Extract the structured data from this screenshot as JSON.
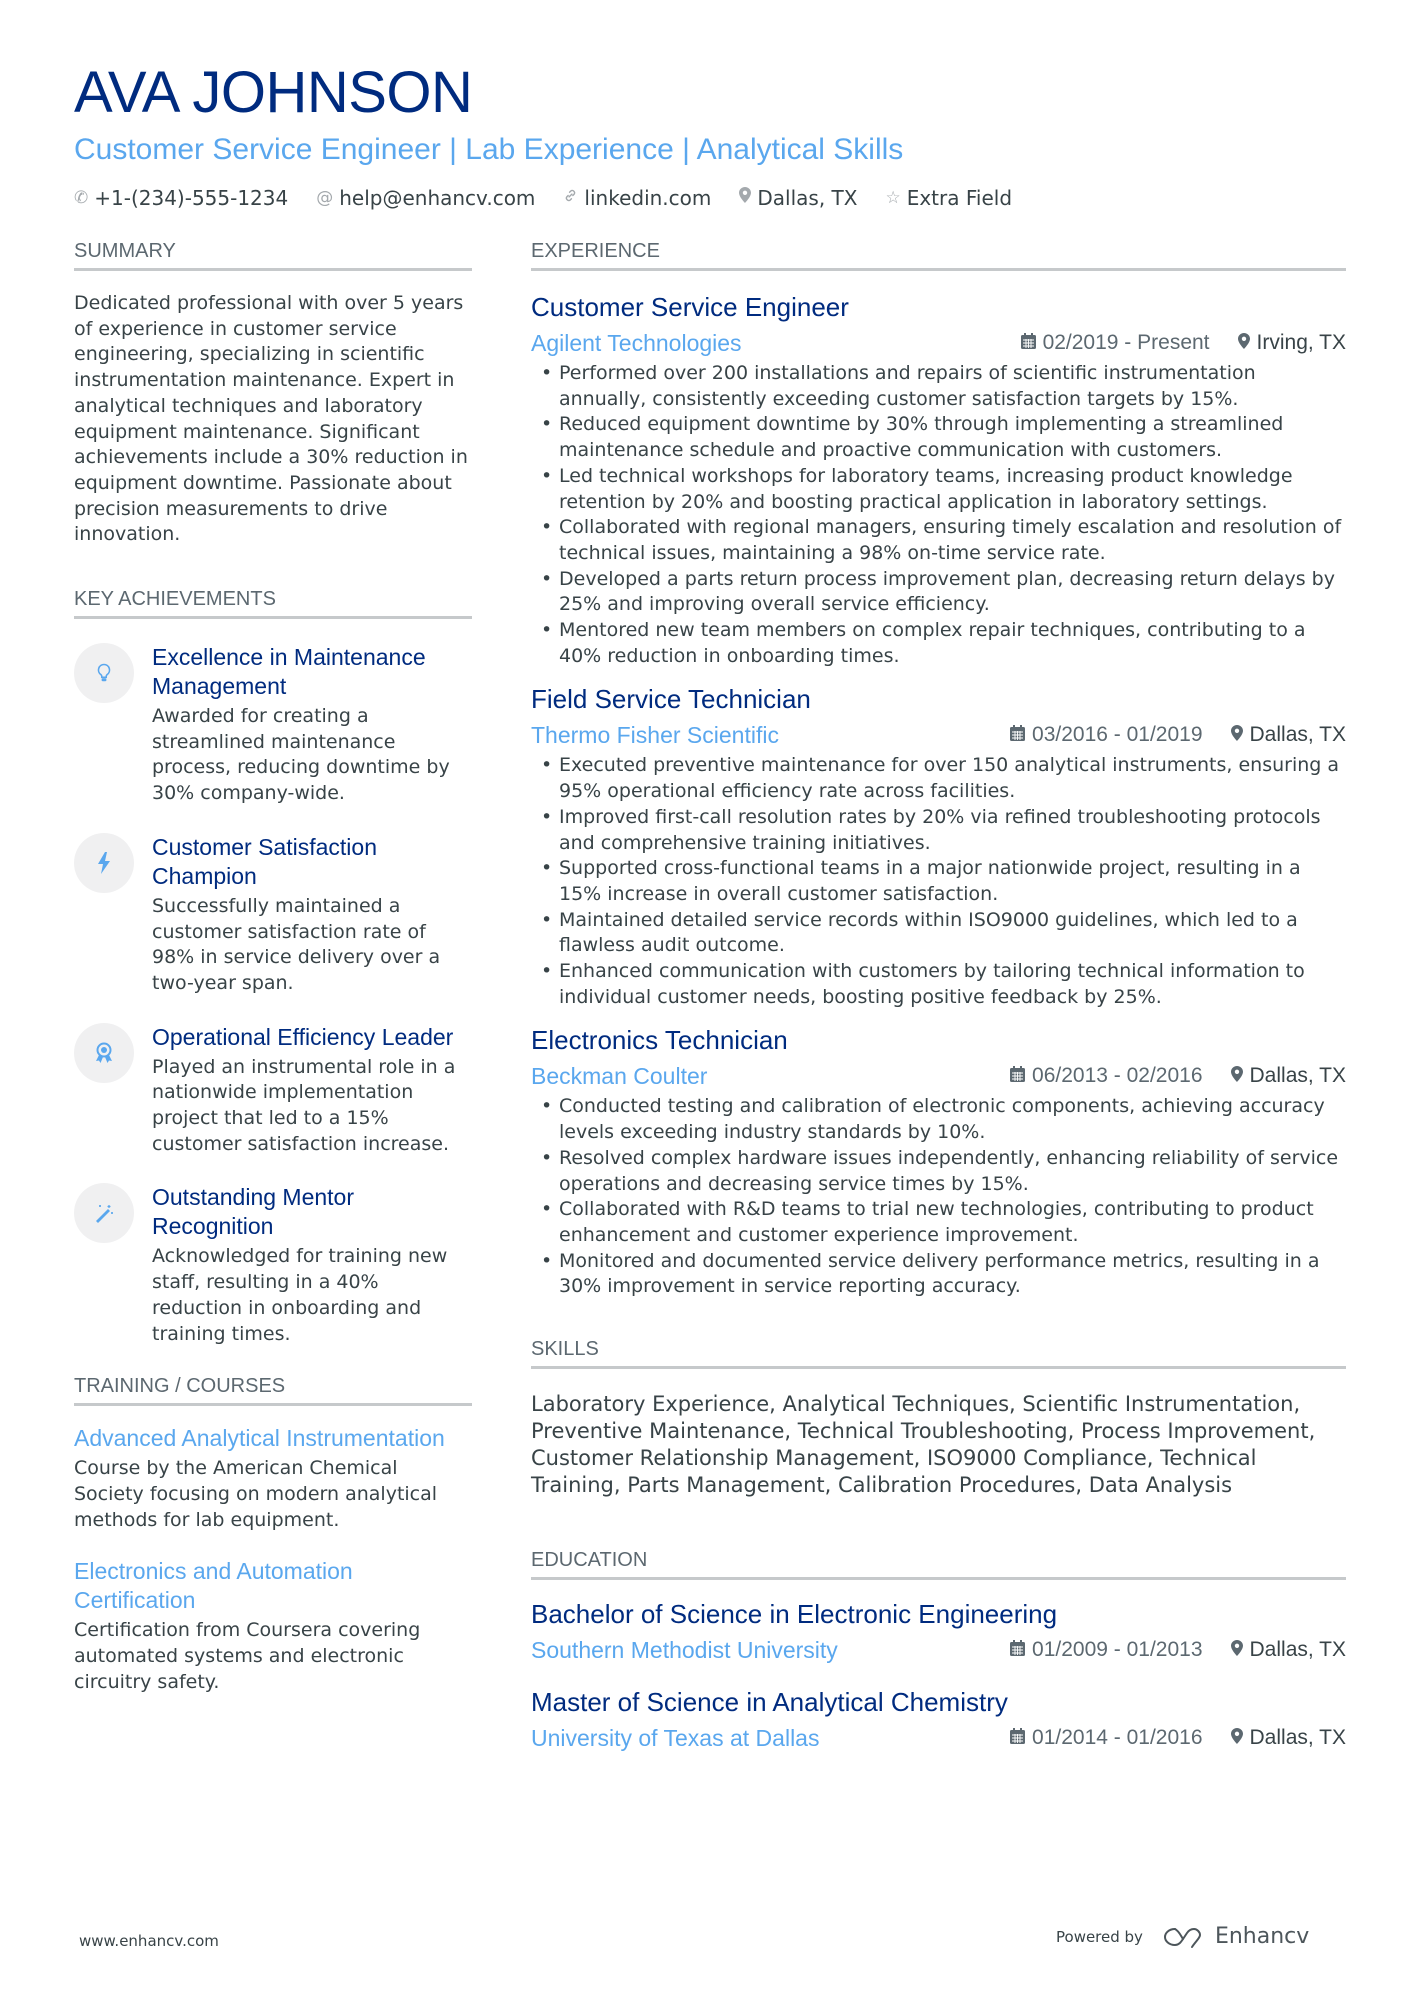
{
  "header": {
    "name": "AVA JOHNSON",
    "headline": "Customer Service Engineer | Lab Experience | Analytical Skills",
    "contacts": [
      {
        "icon": "phone-icon",
        "glyph": "✆",
        "text": "+1-(234)-555-1234"
      },
      {
        "icon": "at-icon",
        "glyph": "@",
        "text": "help@enhancv.com"
      },
      {
        "icon": "link-icon",
        "glyph": "🔗︎",
        "text": "linkedin.com"
      },
      {
        "icon": "location-icon",
        "glyph": "⚲",
        "text": "Dallas, TX"
      },
      {
        "icon": "star-icon",
        "glyph": "☆",
        "text": "Extra Field"
      }
    ]
  },
  "summary": {
    "title": "SUMMARY",
    "text": "Dedicated professional with over 5 years of experience in customer service engineering, specializing in scientific instrumentation maintenance. Expert in analytical techniques and laboratory equipment maintenance. Significant achievements include a 30% reduction in equipment downtime. Passionate about precision measurements to drive innovation."
  },
  "achievements": {
    "title": "KEY ACHIEVEMENTS",
    "items": [
      {
        "icon": "lightbulb-icon",
        "title": "Excellence in Maintenance Management",
        "desc": "Awarded for creating a streamlined maintenance process, reducing downtime by 30% company-wide."
      },
      {
        "icon": "lightning-icon",
        "title": "Customer Satisfaction Champion",
        "desc": "Successfully maintained a customer satisfaction rate of 98% in service delivery over a two-year span."
      },
      {
        "icon": "award-ribbon-icon",
        "title": "Operational Efficiency Leader",
        "desc": "Played an instrumental role in a nationwide implementation project that led to a 15% customer satisfaction increase."
      },
      {
        "icon": "magic-wand-icon",
        "title": "Outstanding Mentor Recognition",
        "desc": "Acknowledged for training new staff, resulting in a 40% reduction in onboarding and training times."
      }
    ]
  },
  "training": {
    "title": "TRAINING / COURSES",
    "items": [
      {
        "title": "Advanced Analytical Instrumentation",
        "desc": "Course by the American Chemical Society focusing on modern analytical methods for lab equipment."
      },
      {
        "title": "Electronics and Automation Certification",
        "desc": "Certification from Coursera covering automated systems and electronic circuitry safety."
      }
    ]
  },
  "experience": {
    "title": "EXPERIENCE",
    "jobs": [
      {
        "title": "Customer Service Engineer",
        "company": "Agilent Technologies",
        "dates": "02/2019 - Present",
        "location": "Irving, TX",
        "bullets": [
          "Performed over 200 installations and repairs of scientific instrumentation annually, consistently exceeding customer satisfaction targets by 15%.",
          "Reduced equipment downtime by 30% through implementing a streamlined maintenance schedule and proactive communication with customers.",
          "Led technical workshops for laboratory teams, increasing product knowledge retention by 20% and boosting practical application in laboratory settings.",
          "Collaborated with regional managers, ensuring timely escalation and resolution of technical issues, maintaining a 98% on-time service rate.",
          "Developed a parts return process improvement plan, decreasing return delays by 25% and improving overall service efficiency.",
          "Mentored new team members on complex repair techniques, contributing to a 40% reduction in onboarding times."
        ]
      },
      {
        "title": "Field Service Technician",
        "company": "Thermo Fisher Scientific",
        "dates": "03/2016 - 01/2019",
        "location": "Dallas, TX",
        "bullets": [
          "Executed preventive maintenance for over 150 analytical instruments, ensuring a 95% operational efficiency rate across facilities.",
          "Improved first-call resolution rates by 20% via refined troubleshooting protocols and comprehensive training initiatives.",
          "Supported cross-functional teams in a major nationwide project, resulting in a 15% increase in overall customer satisfaction.",
          "Maintained detailed service records within ISO9000 guidelines, which led to a flawless audit outcome.",
          "Enhanced communication with customers by tailoring technical information to individual customer needs, boosting positive feedback by 25%."
        ]
      },
      {
        "title": "Electronics Technician",
        "company": "Beckman Coulter",
        "dates": "06/2013 - 02/2016",
        "location": "Dallas, TX",
        "bullets": [
          "Conducted testing and calibration of electronic components, achieving accuracy levels exceeding industry standards by 10%.",
          "Resolved complex hardware issues independently, enhancing reliability of service operations and decreasing service times by 15%.",
          "Collaborated with R&D teams to trial new technologies, contributing to product enhancement and customer experience improvement.",
          "Monitored and documented service delivery performance metrics, resulting in a 30% improvement in service reporting accuracy."
        ]
      }
    ]
  },
  "skills": {
    "title": "SKILLS",
    "text": "Laboratory Experience, Analytical Techniques, Scientific Instrumentation, Preventive Maintenance, Technical Troubleshooting, Process Improvement, Customer Relationship Management, ISO9000 Compliance, Technical Training, Parts Management, Calibration Procedures, Data Analysis"
  },
  "education": {
    "title": "EDUCATION",
    "items": [
      {
        "degree": "Bachelor of Science in Electronic Engineering",
        "school": "Southern Methodist University",
        "dates": "01/2009 - 01/2013",
        "location": "Dallas, TX"
      },
      {
        "degree": "Master of Science in Analytical Chemistry",
        "school": "University of Texas at Dallas",
        "dates": "01/2014 - 01/2016",
        "location": "Dallas, TX"
      }
    ]
  },
  "footer": {
    "website": "www.enhancv.com",
    "powered_by": "Powered by",
    "brand": "Enhancv"
  }
}
